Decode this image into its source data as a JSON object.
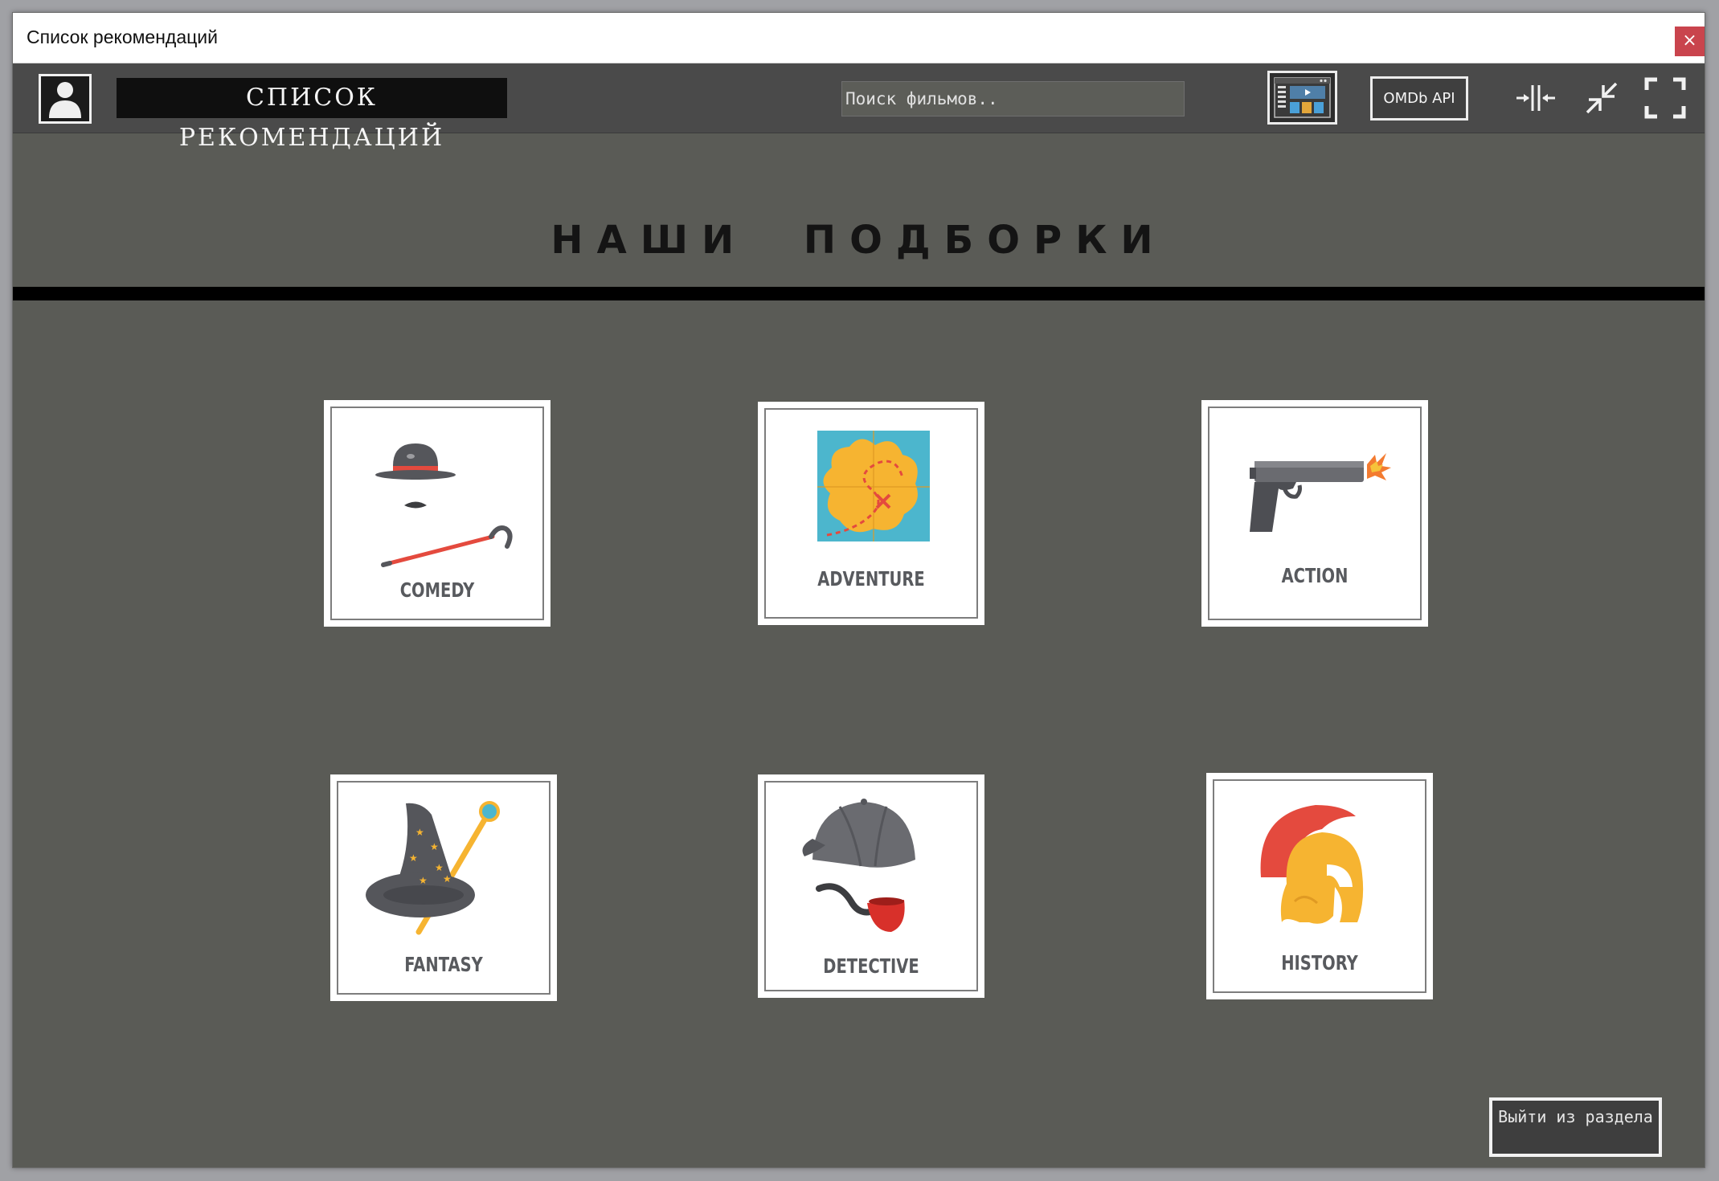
{
  "window": {
    "title": "Список рекомендаций",
    "close_label": "×"
  },
  "toolbar": {
    "brand_title": "СПИСОК РЕКОМЕНДАЦИЙ",
    "search_placeholder": "Поиск фильмов..",
    "omdb_label": "OMDb API",
    "icons": [
      "user-icon",
      "media-panel-icon",
      "collapse-horizontal-icon",
      "minimize-icon",
      "fullscreen-icon"
    ]
  },
  "main": {
    "heading": "НАШИ ПОДБОРКИ",
    "genres": [
      {
        "label": "COMEDY",
        "icon": "bowler-hat-cane-icon"
      },
      {
        "label": "ADVENTURE",
        "icon": "treasure-map-icon"
      },
      {
        "label": "ACTION",
        "icon": "pistol-icon"
      },
      {
        "label": "FANTASY",
        "icon": "wizard-hat-icon"
      },
      {
        "label": "DETECTIVE",
        "icon": "deerstalker-pipe-icon"
      },
      {
        "label": "HISTORY",
        "icon": "spartan-helmet-icon"
      }
    ],
    "exit_label": "Выйти из раздела"
  },
  "colors": {
    "background": "#5a5b56",
    "toolbar": "#4a4a4a",
    "close_button": "#c9444d",
    "card": "#ffffff"
  }
}
